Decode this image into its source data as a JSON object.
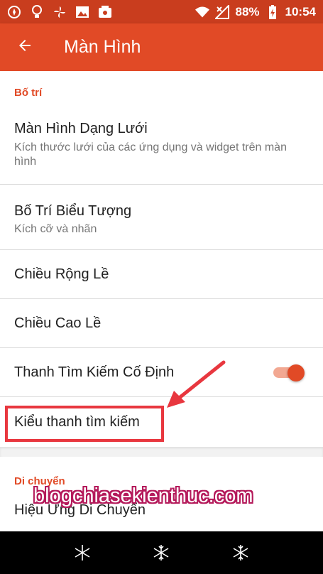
{
  "status_bar": {
    "battery": "88%",
    "time": "10:54",
    "icons": [
      "compass-icon",
      "bulb-icon",
      "fan-icon",
      "photo-icon",
      "app-icon",
      "wifi-icon",
      "signal-icon",
      "battery-icon"
    ]
  },
  "app_bar": {
    "title": "Màn Hình"
  },
  "section_layout": {
    "header": "Bố trí",
    "items": [
      {
        "title": "Màn Hình Dạng Lưới",
        "subtitle": "Kích thước lưới của các ứng dụng và widget trên màn hình"
      },
      {
        "title": "Bố Trí Biểu Tượng",
        "subtitle": "Kích cỡ và nhãn"
      },
      {
        "title": "Chiều Rộng Lề"
      },
      {
        "title": "Chiều Cao Lề"
      },
      {
        "title": "Thanh Tìm Kiếm Cố Định",
        "toggle_on": true
      },
      {
        "title": "Kiểu thanh tìm kiếm"
      }
    ]
  },
  "section_scroll": {
    "header": "Di chuyển",
    "items": [
      {
        "title": "Hiệu Ứng Di Chuyển"
      }
    ]
  },
  "watermark": "blogchiasekienthuc.com",
  "colors": {
    "accent": "#e14a26",
    "status_bar": "#c93d1e",
    "annotation": "#e8373f"
  }
}
